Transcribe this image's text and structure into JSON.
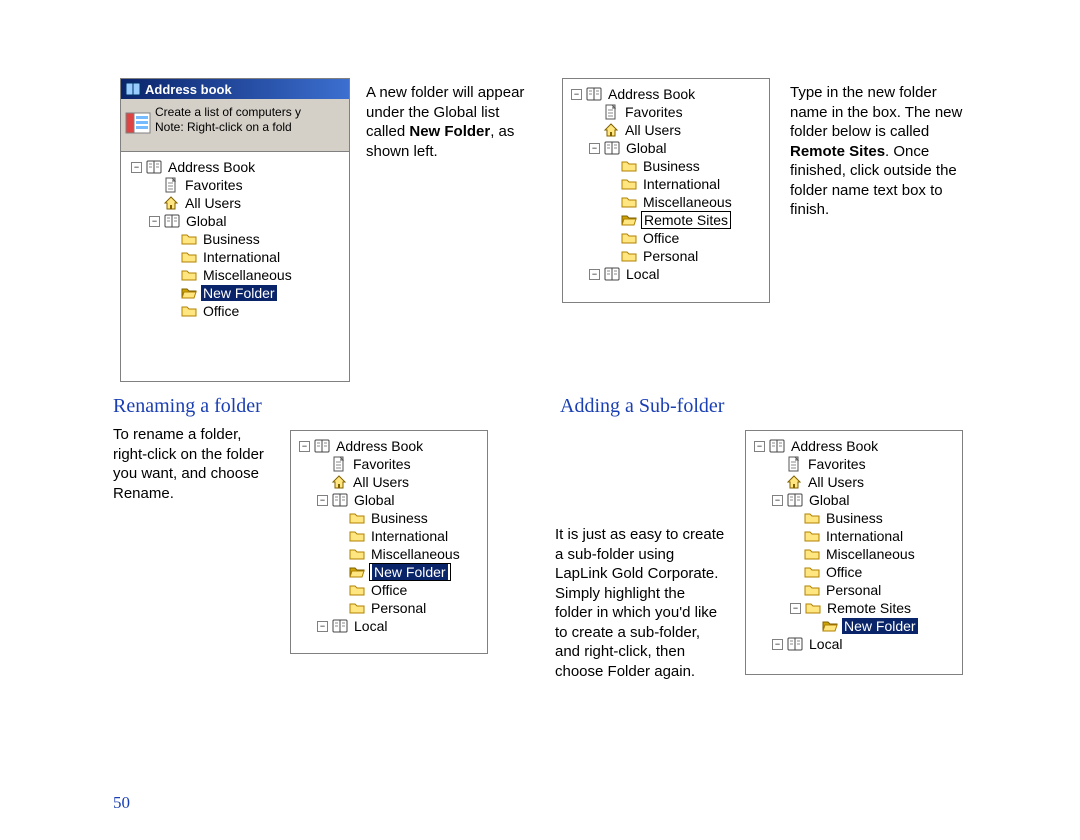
{
  "page_number": "50",
  "section1": {
    "titlebar": "Address book",
    "hint_line1": "Create a list of computers y",
    "hint_line2": "Note: Right-click on a fold",
    "para_before_bold": "A new folder will appear under the Global list called ",
    "bold1": "New Folder",
    "para_after_bold": ", as shown left."
  },
  "section2": {
    "heading": "Renaming a folder",
    "para": "To rename a folder, right-click on the folder you want, and choose Rename."
  },
  "section3": {
    "para_before": "Type in the new folder name in the box.  The new folder below is called ",
    "bold": "Remote Sites",
    "para_after": ". Once finished, click outside the folder name text box to fin­ish."
  },
  "section4": {
    "heading": "Adding a Sub-folder",
    "para": "It is just as easy to create a sub-folder using LapLink Gold Corporate.  Simply highlight the folder in which you'd like to create a sub-folder, and right-click, then choose Folder again."
  },
  "labels": {
    "address_book": "Address Book",
    "favorites": "Favorites",
    "all_users": "All Users",
    "global": "Global",
    "business": "Business",
    "international": "International",
    "miscellaneous": "Miscellaneous",
    "new_folder": "New Folder",
    "remote_sites": "Remote Sites",
    "office": "Office",
    "personal": "Personal",
    "local": "Local"
  }
}
